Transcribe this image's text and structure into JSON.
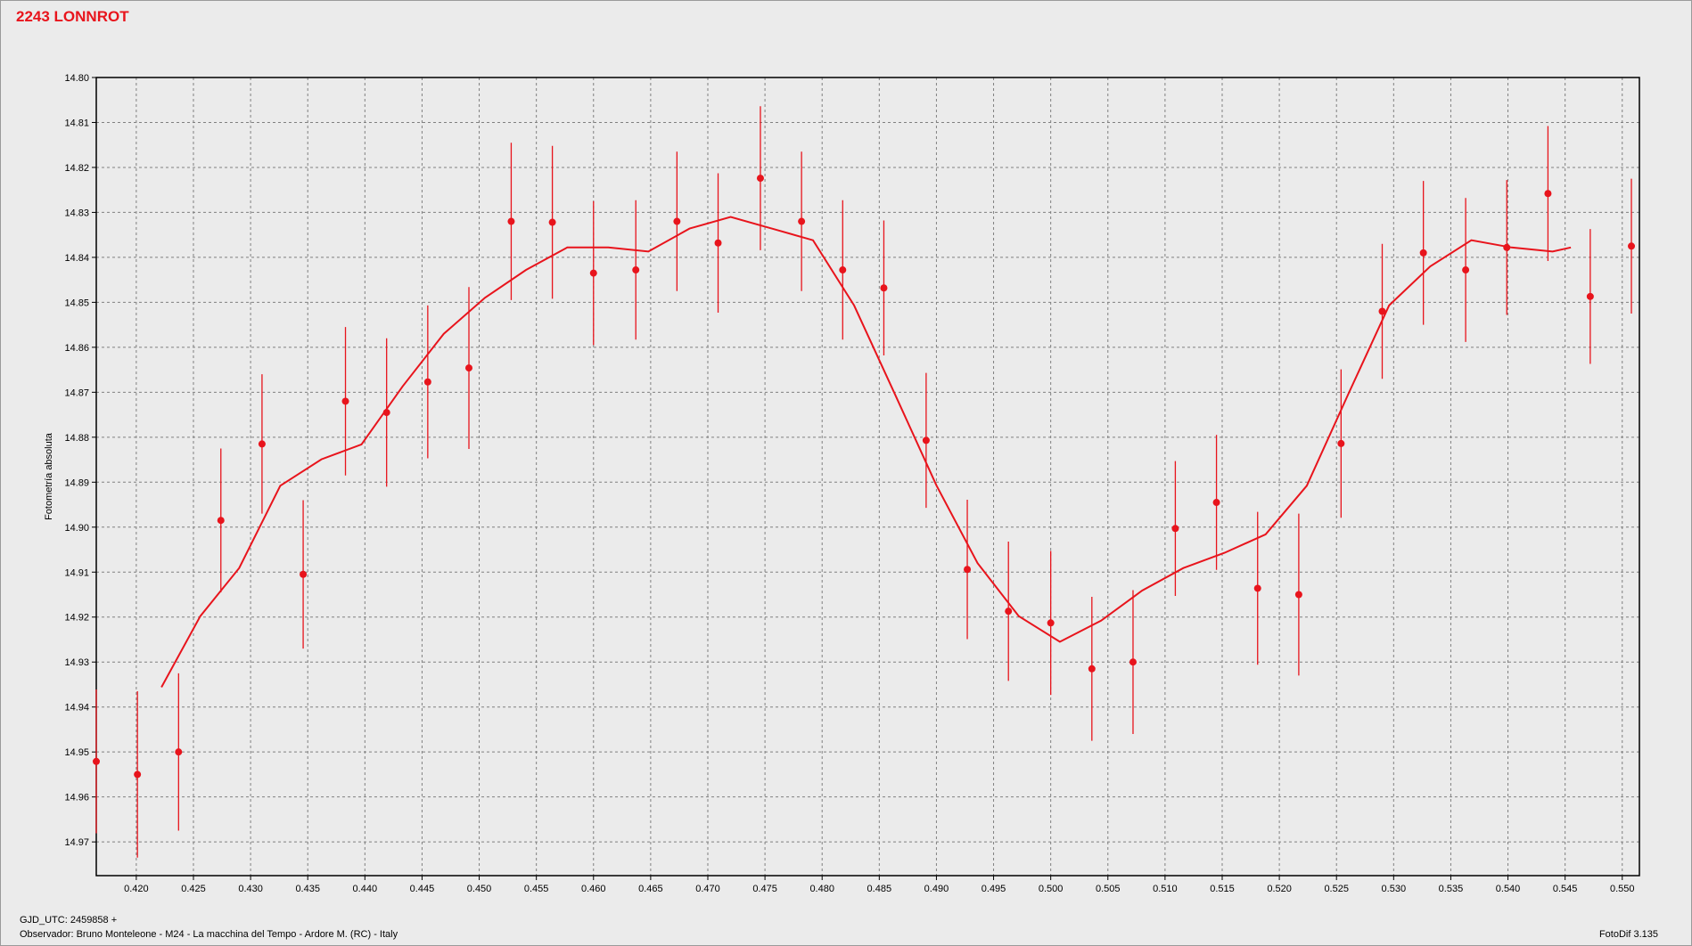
{
  "title": "2243 LONNROT",
  "footer": {
    "gjd": "GJD_UTC: 2459858 +",
    "observer": "Observador: Bruno Monteleone - M24 - La macchina del Tempo - Ardore M. (RC) - Italy",
    "software": "FotoDif 3.135"
  },
  "colors": {
    "series": "#e8141c",
    "background": "#ebebeb",
    "grid": "#808080"
  },
  "chart_data": {
    "type": "scatter",
    "title": "2243 LONNROT",
    "xlabel": "",
    "ylabel": "Fotometría absoluta",
    "xlim": [
      0.4165,
      0.5515
    ],
    "ylim": [
      14.8,
      14.9775
    ],
    "y_inverted": true,
    "grid": true,
    "x_ticks": [
      "0.420",
      "0.425",
      "0.430",
      "0.435",
      "0.440",
      "0.445",
      "0.450",
      "0.455",
      "0.460",
      "0.465",
      "0.470",
      "0.475",
      "0.480",
      "0.485",
      "0.490",
      "0.495",
      "0.500",
      "0.505",
      "0.510",
      "0.515",
      "0.520",
      "0.525",
      "0.530",
      "0.535",
      "0.540",
      "0.545",
      "0.550"
    ],
    "y_ticks": [
      "14.80",
      "14.81",
      "14.82",
      "14.83",
      "14.84",
      "14.85",
      "14.86",
      "14.87",
      "14.88",
      "14.89",
      "14.90",
      "14.91",
      "14.92",
      "14.93",
      "14.94",
      "14.95",
      "14.96",
      "14.97"
    ],
    "series": [
      {
        "type": "errorbar",
        "x": [
          0.4165,
          0.4201,
          0.4237,
          0.4274,
          0.431,
          0.4346,
          0.4383,
          0.4419,
          0.4455,
          0.4491,
          0.4528,
          0.4564,
          0.46,
          0.4637,
          0.4673,
          0.4709,
          0.4746,
          0.4782,
          0.4818,
          0.4854,
          0.4891,
          0.4927,
          0.4963,
          0.5,
          0.5036,
          0.5072,
          0.5109,
          0.5145,
          0.5181,
          0.5217,
          0.5254,
          0.529,
          0.5326,
          0.5363,
          0.5399,
          0.5435,
          0.5472,
          0.5508
        ],
        "y": [
          14.9521,
          14.955,
          14.95,
          14.8985,
          14.8815,
          14.9105,
          14.872,
          14.8745,
          14.8677,
          14.8646,
          14.832,
          14.8322,
          14.8435,
          14.8428,
          14.832,
          14.8368,
          14.8224,
          14.832,
          14.8428,
          14.8468,
          14.8807,
          14.9094,
          14.9187,
          14.9213,
          14.9315,
          14.93,
          14.9003,
          14.8945,
          14.9136,
          14.915,
          14.8814,
          14.852,
          14.839,
          14.8428,
          14.8378,
          14.8258,
          14.8487,
          14.8375
        ],
        "err": [
          0.016,
          0.0185,
          0.0175,
          0.016,
          0.0155,
          0.0165,
          0.0165,
          0.0165,
          0.017,
          0.018,
          0.0175,
          0.017,
          0.016,
          0.0155,
          0.0155,
          0.0155,
          0.016,
          0.0155,
          0.0155,
          0.015,
          0.015,
          0.0155,
          0.0155,
          0.016,
          0.016,
          0.016,
          0.015,
          0.015,
          0.017,
          0.018,
          0.0165,
          0.015,
          0.016,
          0.016,
          0.015,
          0.015,
          0.015,
          0.015
        ]
      },
      {
        "type": "line",
        "x": [
          0.4222,
          0.4256,
          0.429,
          0.4326,
          0.4362,
          0.4397,
          0.4433,
          0.4469,
          0.4505,
          0.4541,
          0.4577,
          0.4613,
          0.4648,
          0.4684,
          0.472,
          0.4756,
          0.4792,
          0.4828,
          0.4864,
          0.49,
          0.4936,
          0.4972,
          0.5008,
          0.5044,
          0.508,
          0.5116,
          0.5152,
          0.5188,
          0.5224,
          0.526,
          0.5296,
          0.5332,
          0.5368,
          0.5403,
          0.5439,
          0.5455
        ],
        "y": [
          14.9356,
          14.9198,
          14.9091,
          14.8908,
          14.8849,
          14.8816,
          14.8687,
          14.857,
          14.849,
          14.8428,
          14.8378,
          14.8378,
          14.8387,
          14.8336,
          14.831,
          14.8336,
          14.8362,
          14.8507,
          14.8706,
          14.8907,
          14.908,
          14.9198,
          14.9255,
          14.9208,
          14.9141,
          14.9091,
          14.9057,
          14.9016,
          14.8908,
          14.8706,
          14.8507,
          14.842,
          14.8362,
          14.8378,
          14.8387,
          14.8378
        ]
      }
    ]
  }
}
